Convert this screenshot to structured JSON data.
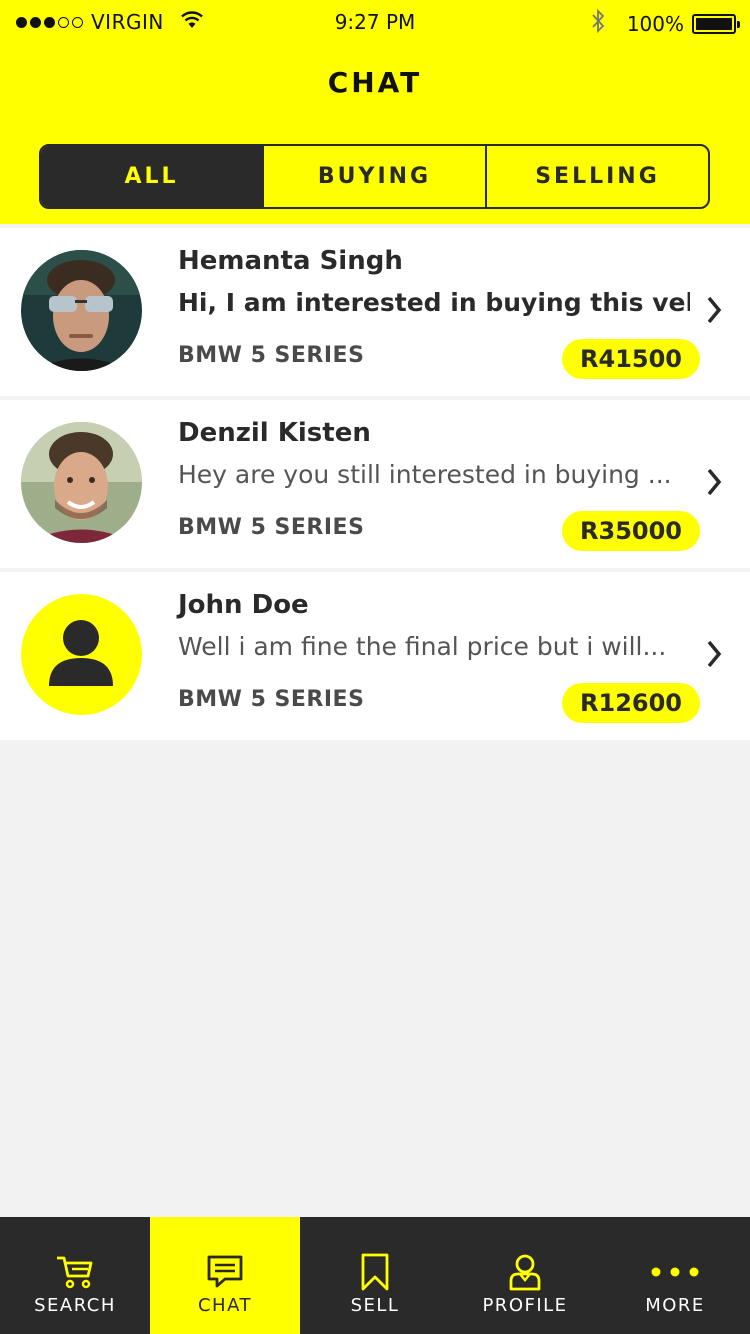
{
  "status_bar": {
    "carrier": "VIRGIN",
    "time": "9:27 PM",
    "battery": "100%"
  },
  "header": {
    "title": "CHAT"
  },
  "segments": [
    {
      "label": "ALL",
      "active": true
    },
    {
      "label": "BUYING",
      "active": false
    },
    {
      "label": "SELLING",
      "active": false
    }
  ],
  "chats": [
    {
      "name": "Hemanta Singh",
      "message": "Hi, I am interested in buying this vehi...",
      "unread": true,
      "model": "BMW 5 SERIES",
      "price": "R41500",
      "avatar": "photo-man-sunglasses"
    },
    {
      "name": "Denzil Kisten",
      "message": "Hey are you still interested in buying ...",
      "unread": false,
      "model": "BMW 5 SERIES",
      "price": "R35000",
      "avatar": "photo-man-smiling"
    },
    {
      "name": "John Doe",
      "message": "Well i am fine the final price but i will...",
      "unread": false,
      "model": "BMW 5 SERIES",
      "price": "R12600",
      "avatar": "person-placeholder-icon"
    }
  ],
  "tab_bar": [
    {
      "label": "SEARCH",
      "icon": "cart-icon",
      "active": false
    },
    {
      "label": "CHAT",
      "icon": "chat-bubble-icon",
      "active": true
    },
    {
      "label": "SELL",
      "icon": "bookmark-icon",
      "active": false
    },
    {
      "label": "PROFILE",
      "icon": "user-icon",
      "active": false
    },
    {
      "label": "MORE",
      "icon": "more-dots-icon",
      "active": false
    }
  ],
  "colors": {
    "accent": "#ffff00",
    "dark": "#2a2a2a",
    "background": "#f2f2f2"
  }
}
